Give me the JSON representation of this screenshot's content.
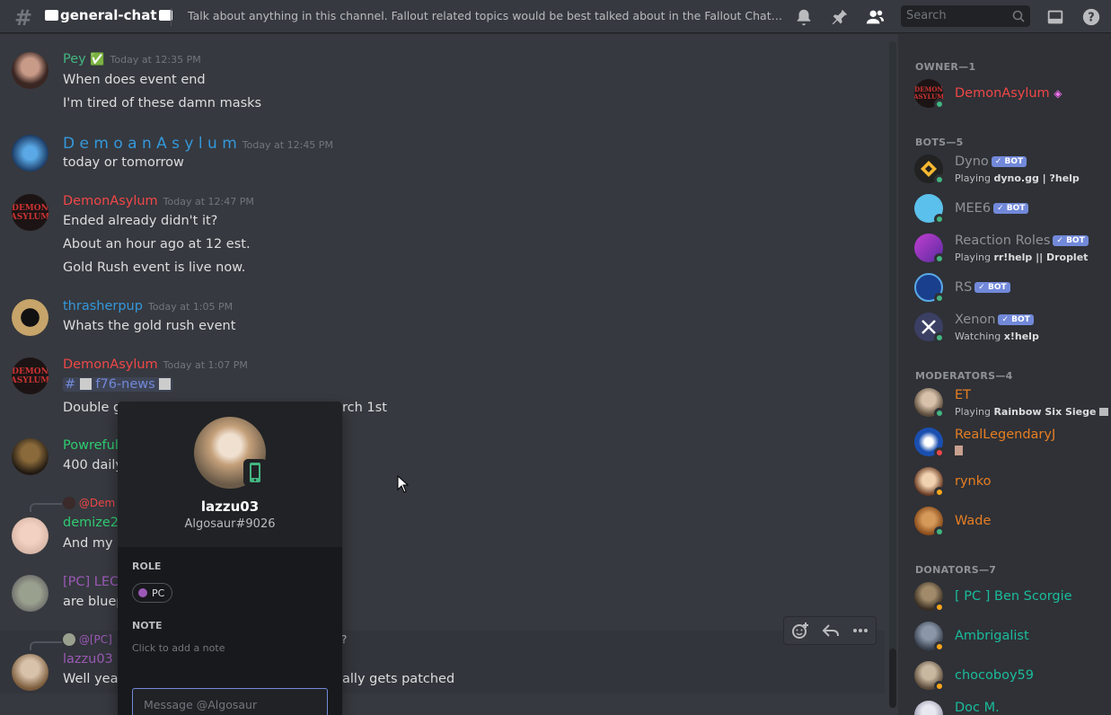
{
  "header": {
    "channel": "general-chat",
    "topic": "Talk about anything in this channel. Fallout related topics would be best talked about in the Fallout Chat, but it's ...",
    "search_placeholder": "Search"
  },
  "messages": [
    {
      "author": "Pey",
      "badge": "✅",
      "color": "#43b581",
      "time": "Today at 12:35 PM",
      "lines": [
        "When does event end",
        "I'm tired of these damn masks"
      ]
    },
    {
      "author": "D e m o a n A s y l u m",
      "color": "#3498db",
      "time": "Today at 12:45 PM",
      "lines": [
        "today or tomorrow"
      ]
    },
    {
      "author": "DemonAsylum",
      "color": "#f04747",
      "time": "Today at 12:47 PM",
      "lines": [
        "Ended already didn't it?",
        "About an hour ago at 12 est.",
        "Gold Rush event is live now."
      ]
    },
    {
      "author": "thrasherpup",
      "color": "#3498db",
      "time": "Today at 1:05 PM",
      "lines": [
        "Whats the gold rush event"
      ]
    },
    {
      "author": "DemonAsylum",
      "color": "#f04747",
      "time": "Today at 1:07 PM",
      "mention": "f76-news",
      "lines": [
        "Double g",
        "rch 1st"
      ]
    },
    {
      "author": "Powreful",
      "color": "#2ecc71",
      "lines": [
        "400 daily"
      ]
    },
    {
      "reply_to": "@Dem",
      "author": "demize2",
      "color": "#2ecc71",
      "lines": [
        "And my I"
      ]
    },
    {
      "author": "[PC] LEC",
      "color": "#9b59b6",
      "lines": [
        "are  bluep"
      ]
    },
    {
      "reply_to": "@[PC]",
      "reply_tail": "?",
      "author": "lazzu03",
      "color": "#9b59b6",
      "lines": [
        "Well yea",
        "ally gets patched"
      ]
    }
  ],
  "popout": {
    "username": "lazzu03",
    "tag": "Algosaur#9026",
    "role_label": "ROLE",
    "role": "PC",
    "note_label": "NOTE",
    "note_placeholder": "Click to add a note",
    "message_placeholder": "Message @Algosaur"
  },
  "members": {
    "categories": [
      "OWNER—1",
      "BOTS—5",
      "MODERATORS—4",
      "DONATORS—7"
    ],
    "owner": [
      {
        "name": "DemonAsylum",
        "color": "#f04747"
      }
    ],
    "bots": [
      {
        "name": "Dyno",
        "badge": "✓ BOT",
        "activity_prefix": "Playing ",
        "activity": "dyno.gg | ?help"
      },
      {
        "name": "MEE6",
        "badge": "✓ BOT"
      },
      {
        "name": "Reaction Roles",
        "badge": "✓ BOT",
        "activity_prefix": "Playing ",
        "activity": "rr!help || Droplet"
      },
      {
        "name": "RS",
        "badge": "✓ BOT"
      },
      {
        "name": "Xenon",
        "badge": "✓ BOT",
        "activity_prefix": "Watching ",
        "activity": "x!help"
      }
    ],
    "moderators": [
      {
        "name": "ET",
        "color": "#e67e22",
        "activity_prefix": "Playing ",
        "activity": "Rainbow Six Siege"
      },
      {
        "name": "RealLegendaryJ",
        "color": "#e67e22"
      },
      {
        "name": "rynko",
        "color": "#e67e22"
      },
      {
        "name": "Wade",
        "color": "#e67e22"
      }
    ],
    "donators": [
      {
        "name": "[ PC ] Ben Scorgie",
        "color": "#1abc9c"
      },
      {
        "name": "Ambrigalist",
        "color": "#1abc9c"
      },
      {
        "name": "chocoboy59",
        "color": "#1abc9c"
      },
      {
        "name": "Doc M.",
        "color": "#1abc9c"
      }
    ]
  }
}
